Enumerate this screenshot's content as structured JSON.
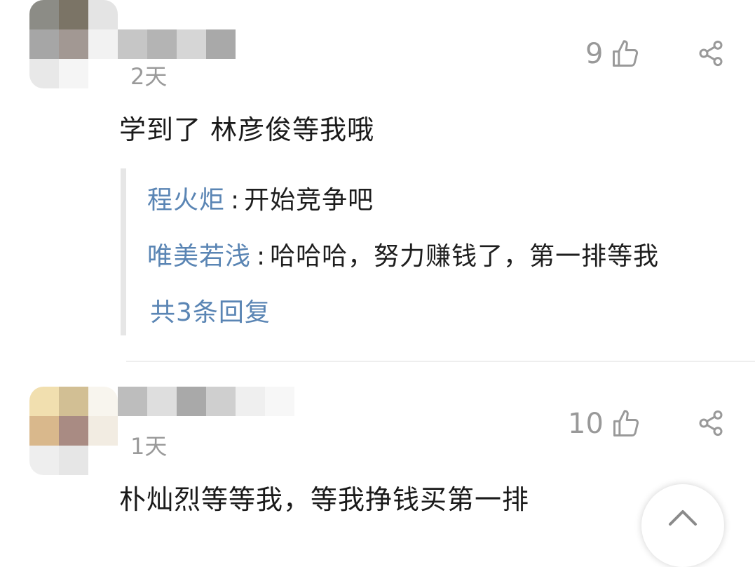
{
  "comments": [
    {
      "time": "2天",
      "likes": "9",
      "text": "学到了 林彦俊等我哦",
      "replies": [
        {
          "name": "程火炬",
          "text": "开始竞争吧"
        },
        {
          "name": "唯美若浅",
          "text": "哈哈哈，努力赚钱了，第一排等我"
        }
      ],
      "more_replies": "共3条回复",
      "avatar_tiles": [
        "#8c8c86",
        "#7b7466",
        "#e4e4e4",
        "#a6a6a6",
        "#a29893",
        "#f2f2f2",
        "#e8e8e8",
        "#f5f5f5",
        "#ffffff"
      ],
      "nick_tiles": [
        "#c6c6c6",
        "#b4b4b4",
        "#d6d6d6",
        "#a9a9a9"
      ]
    },
    {
      "time": "1天",
      "likes": "10",
      "text": "朴灿烈等等我，等我挣钱买第一排",
      "avatar_tiles": [
        "#f1dfaf",
        "#d2bf94",
        "#f8f5ee",
        "#d9b88c",
        "#a98b83",
        "#f2ece2",
        "#eeeeee",
        "#e6e6e6",
        "#ffffff"
      ],
      "nick_tiles": [
        "#bdbdbd",
        "#dedede",
        "#a9a9a9",
        "#cfcfcf",
        "#efefef",
        "#f7f7f7"
      ]
    }
  ],
  "icons": {
    "like": "thumbs-up-icon",
    "share": "share-icon",
    "scroll_top": "chevron-up-icon"
  },
  "colors": {
    "link": "#5a85b4",
    "muted": "#999999"
  }
}
